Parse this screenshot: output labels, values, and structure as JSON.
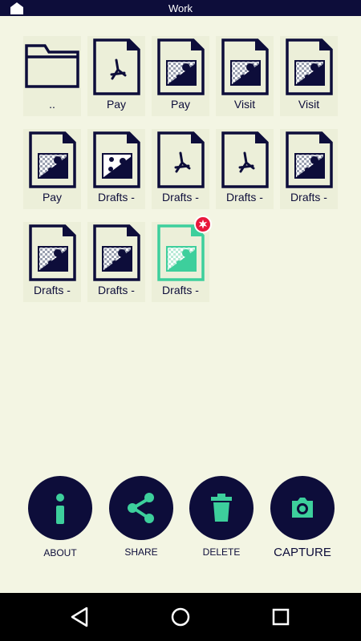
{
  "titlebar": {
    "title": "Work",
    "home_icon": "home-icon"
  },
  "files": [
    {
      "label": "..",
      "type": "folder"
    },
    {
      "label": "Pay",
      "type": "pdf"
    },
    {
      "label": "Pay",
      "type": "image"
    },
    {
      "label": "Visit",
      "type": "image"
    },
    {
      "label": "Visit",
      "type": "image"
    },
    {
      "label": "Pay",
      "type": "image"
    },
    {
      "label": "Drafts -",
      "type": "photo"
    },
    {
      "label": "Drafts -",
      "type": "pdf"
    },
    {
      "label": "Drafts -",
      "type": "pdf"
    },
    {
      "label": "Drafts -",
      "type": "image"
    },
    {
      "label": "Drafts -",
      "type": "image"
    },
    {
      "label": "Drafts -",
      "type": "image"
    },
    {
      "label": "Drafts -",
      "type": "image",
      "highlighted": true,
      "badge": "new-badge-icon"
    }
  ],
  "actions": {
    "about": {
      "label": "ABOUT",
      "icon": "info-icon"
    },
    "share": {
      "label": "SHARE",
      "icon": "share-icon"
    },
    "delete": {
      "label": "DELETE",
      "icon": "trash-icon"
    },
    "capture": {
      "label": "CAPTURE",
      "icon": "camera-icon"
    }
  },
  "navbar": {
    "back_icon": "back-icon",
    "home_icon": "home-circle-icon",
    "recents_icon": "recents-icon"
  },
  "colors": {
    "background": "#f3f5e3",
    "tile": "#ecefd9",
    "navy": "#0d0d3a",
    "accent": "#3dcf9c",
    "badge": "#e8183c"
  }
}
